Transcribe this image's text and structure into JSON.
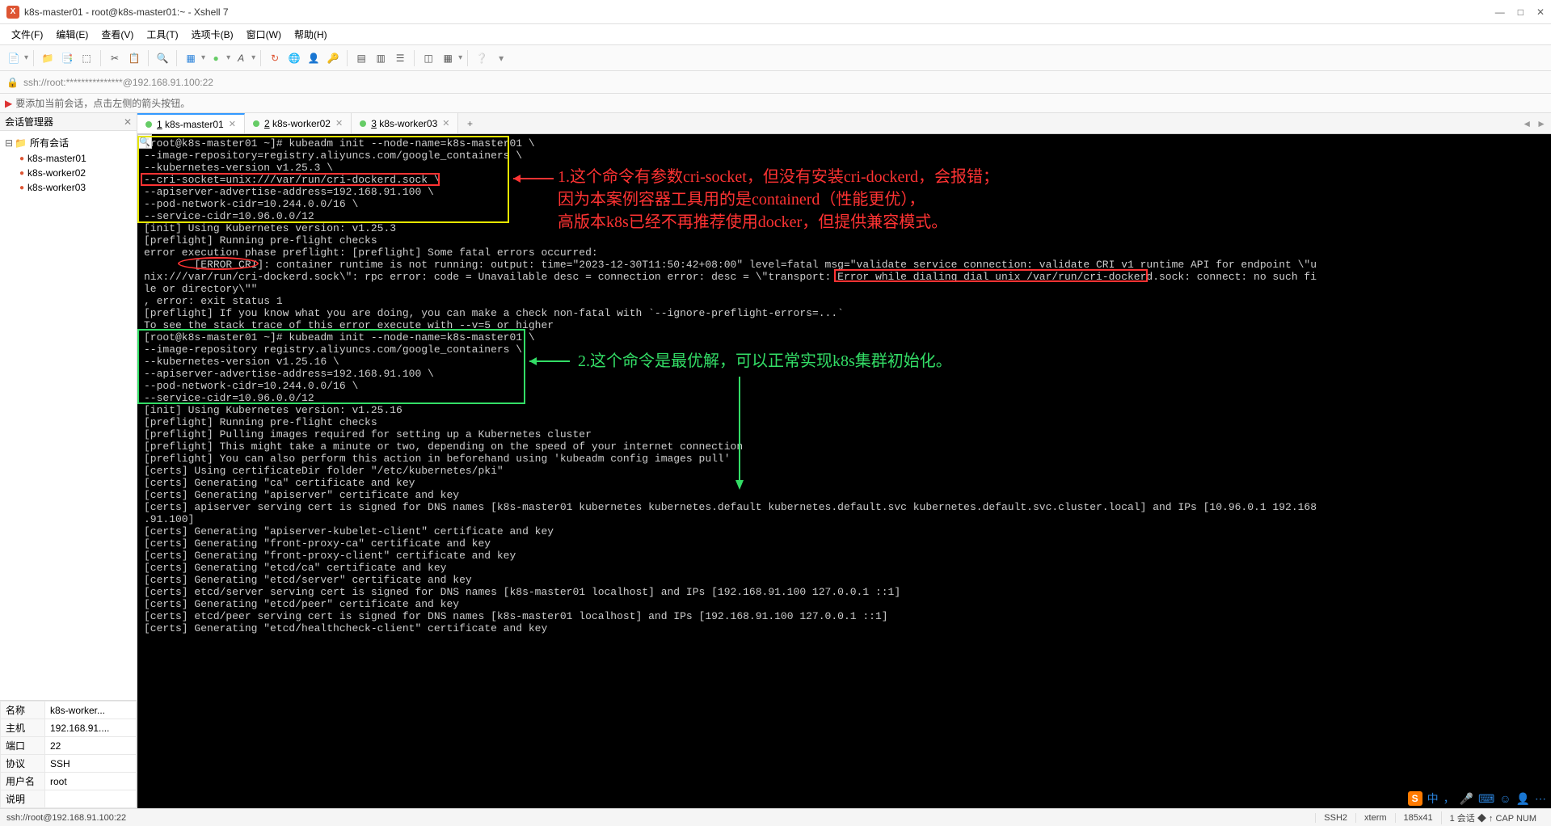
{
  "window": {
    "title": "k8s-master01 - root@k8s-master01:~ - Xshell 7"
  },
  "menu": {
    "file": "文件(F)",
    "edit": "编辑(E)",
    "view": "查看(V)",
    "tools": "工具(T)",
    "tabs": "选项卡(B)",
    "window": "窗口(W)",
    "help": "帮助(H)"
  },
  "addressbar": {
    "text": "ssh://root:***************@192.168.91.100:22"
  },
  "hint": {
    "text": "要添加当前会话，点击左侧的箭头按钮。"
  },
  "sidebar": {
    "title": "会话管理器",
    "root": "所有会话",
    "sessions": [
      "k8s-master01",
      "k8s-worker02",
      "k8s-worker03"
    ],
    "props": {
      "name_label": "名称",
      "name_val": "k8s-worker...",
      "host_label": "主机",
      "host_val": "192.168.91....",
      "port_label": "端口",
      "port_val": "22",
      "proto_label": "协议",
      "proto_val": "SSH",
      "user_label": "用户名",
      "user_val": "root",
      "desc_label": "说明",
      "desc_val": ""
    }
  },
  "tabs": [
    {
      "label": "1 k8s-master01",
      "active": true
    },
    {
      "label": "2 k8s-worker02",
      "active": false
    },
    {
      "label": "3 k8s-worker03",
      "active": false
    }
  ],
  "terminal": {
    "lines": [
      "[root@k8s-master01 ~]# kubeadm init --node-name=k8s-master01 \\",
      "--image-repository=registry.aliyuncs.com/google_containers \\",
      "--kubernetes-version v1.25.3 \\",
      "--cri-socket=unix:///var/run/cri-dockerd.sock \\",
      "--apiserver-advertise-address=192.168.91.100 \\",
      "--pod-network-cidr=10.244.0.0/16 \\",
      "--service-cidr=10.96.0.0/12",
      "[init] Using Kubernetes version: v1.25.3",
      "[preflight] Running pre-flight checks",
      "error execution phase preflight: [preflight] Some fatal errors occurred:",
      "        [ERROR CRI]: container runtime is not running: output: time=\"2023-12-30T11:50:42+08:00\" level=fatal msg=\"validate service connection: validate CRI v1 runtime API for endpoint \\\"u",
      "nix:///var/run/cri-dockerd.sock\\\": rpc error: code = Unavailable desc = connection error: desc = \\\"transport: Error while dialing dial unix /var/run/cri-dockerd.sock: connect: no such fi",
      "le or directory\\\"\"",
      ", error: exit status 1",
      "[preflight] If you know what you are doing, you can make a check non-fatal with `--ignore-preflight-errors=...`",
      "To see the stack trace of this error execute with --v=5 or higher",
      "[root@k8s-master01 ~]# kubeadm init --node-name=k8s-master01 \\",
      "--image-repository registry.aliyuncs.com/google_containers \\",
      "--kubernetes-version v1.25.16 \\",
      "--apiserver-advertise-address=192.168.91.100 \\",
      "--pod-network-cidr=10.244.0.0/16 \\",
      "--service-cidr=10.96.0.0/12",
      "[init] Using Kubernetes version: v1.25.16",
      "[preflight] Running pre-flight checks",
      "[preflight] Pulling images required for setting up a Kubernetes cluster",
      "[preflight] This might take a minute or two, depending on the speed of your internet connection",
      "[preflight] You can also perform this action in beforehand using 'kubeadm config images pull'",
      "[certs] Using certificateDir folder \"/etc/kubernetes/pki\"",
      "[certs] Generating \"ca\" certificate and key",
      "[certs] Generating \"apiserver\" certificate and key",
      "[certs] apiserver serving cert is signed for DNS names [k8s-master01 kubernetes kubernetes.default kubernetes.default.svc kubernetes.default.svc.cluster.local] and IPs [10.96.0.1 192.168",
      ".91.100]",
      "[certs] Generating \"apiserver-kubelet-client\" certificate and key",
      "[certs] Generating \"front-proxy-ca\" certificate and key",
      "[certs] Generating \"front-proxy-client\" certificate and key",
      "[certs] Generating \"etcd/ca\" certificate and key",
      "[certs] Generating \"etcd/server\" certificate and key",
      "[certs] etcd/server serving cert is signed for DNS names [k8s-master01 localhost] and IPs [192.168.91.100 127.0.0.1 ::1]",
      "[certs] Generating \"etcd/peer\" certificate and key",
      "[certs] etcd/peer serving cert is signed for DNS names [k8s-master01 localhost] and IPs [192.168.91.100 127.0.0.1 ::1]",
      "[certs] Generating \"etcd/healthcheck-client\" certificate and key"
    ]
  },
  "annotations": {
    "red1": "1.这个命令有参数cri-socket，但没有安装cri-dockerd，会报错；",
    "red2": "因为本案例容器工具用的是containerd（性能更优），",
    "red3": "高版本k8s已经不再推荐使用docker，但提供兼容模式。",
    "green1": "2.这个命令是最优解，可以正常实现k8s集群初始化。"
  },
  "status": {
    "left": "ssh://root@192.168.91.100:22",
    "ssh": "SSH2",
    "term": "xterm",
    "size": "185x41",
    "extra": "1 会话  ◆ ↑  CAP  NUM"
  }
}
